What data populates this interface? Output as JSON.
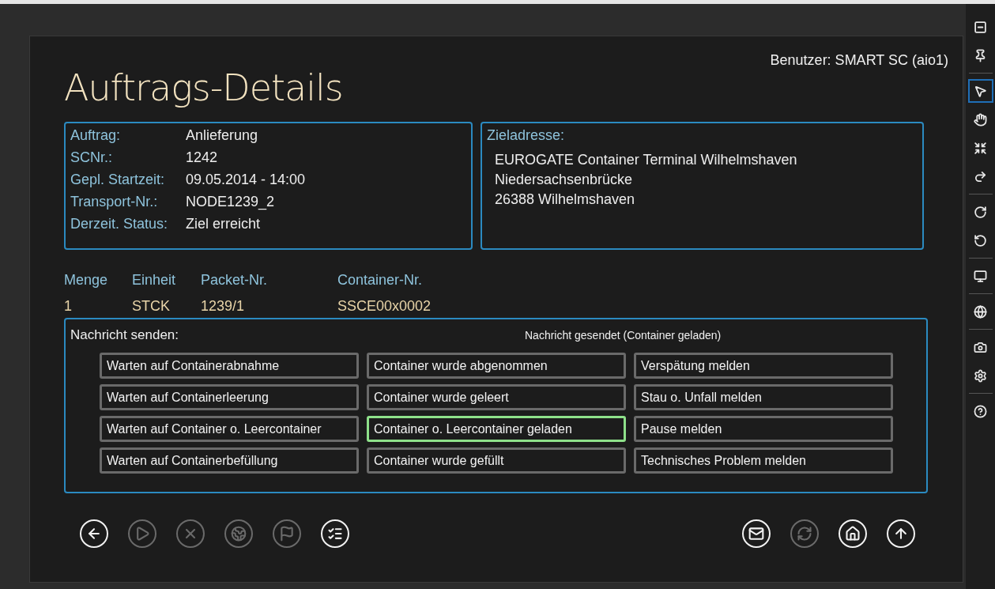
{
  "title": "Auftrags-Details",
  "user": "Benutzer: SMART SC (aio1)",
  "order": [
    {
      "label": "Auftrag:",
      "value": "Anlieferung"
    },
    {
      "label": "SCNr.:",
      "value": "1242"
    },
    {
      "label": "Gepl. Startzeit:",
      "value": "09.05.2014 - 14:00"
    },
    {
      "label": "Transport-Nr.:",
      "value": "NODE1239_2"
    },
    {
      "label": "Derzeit. Status:",
      "value": "Ziel erreicht"
    }
  ],
  "address": {
    "label": "Zieladresse:",
    "lines": [
      "EUROGATE Container Terminal Wilhelmshaven",
      "Niedersachsenbrücke",
      "26388 Wilhelmshaven"
    ]
  },
  "table": {
    "columns": [
      "Menge",
      "Einheit",
      "Packet-Nr.",
      "Container-Nr."
    ],
    "rows": [
      [
        "1",
        "STCK",
        "1239/1",
        "SSCE00x0002"
      ]
    ]
  },
  "messages": {
    "label": "Nachricht senden:",
    "status": "Nachricht gesendet (Container geladen)",
    "buttons": [
      {
        "label": "Warten auf Containerabnahme",
        "selected": false
      },
      {
        "label": "Container wurde abgenommen",
        "selected": false
      },
      {
        "label": "Verspätung melden",
        "selected": false
      },
      {
        "label": "Warten auf Containerleerung",
        "selected": false
      },
      {
        "label": "Container wurde geleert",
        "selected": false
      },
      {
        "label": "Stau o. Unfall melden",
        "selected": false
      },
      {
        "label": "Warten auf Container o. Leercontainer",
        "selected": false
      },
      {
        "label": "Container o. Leercontainer geladen",
        "selected": true
      },
      {
        "label": "Pause melden",
        "selected": false
      },
      {
        "label": "Warten auf Containerbefüllung",
        "selected": false
      },
      {
        "label": "Container wurde gefüllt",
        "selected": false
      },
      {
        "label": "Technisches Problem melden",
        "selected": false
      }
    ]
  },
  "bottom_left": [
    {
      "disabled": false
    },
    {
      "disabled": true
    },
    {
      "disabled": true
    },
    {
      "disabled": true
    },
    {
      "disabled": true
    },
    {
      "disabled": false
    }
  ],
  "bottom_right": [
    {
      "disabled": false
    },
    {
      "disabled": true
    },
    {
      "disabled": false
    },
    {
      "disabled": false
    }
  ],
  "toolbar": {
    "groups": [
      [
        {
          "selected": false
        },
        {
          "selected": false
        }
      ],
      [
        {
          "selected": true
        },
        {
          "selected": false
        },
        {
          "selected": false
        },
        {
          "selected": false
        }
      ],
      [
        {
          "selected": false
        },
        {
          "selected": false
        }
      ],
      [
        {
          "selected": false
        }
      ],
      [
        {
          "selected": false
        }
      ],
      [
        {
          "selected": false
        },
        {
          "selected": false
        }
      ],
      [
        {
          "selected": false
        }
      ]
    ]
  }
}
